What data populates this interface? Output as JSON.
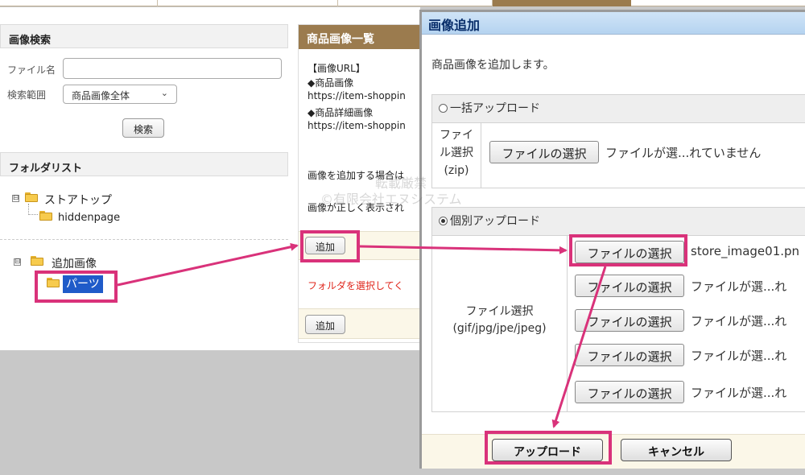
{
  "search": {
    "title": "画像検索",
    "filename_label": "ファイル名",
    "filename_value": "",
    "scope_label": "検索範囲",
    "scope_value": "商品画像全体",
    "search_button": "検索"
  },
  "folders": {
    "title": "フォルダリスト",
    "tree": [
      {
        "label": "ストアトップ",
        "expander": "⊟"
      },
      {
        "label": "hiddenpage"
      },
      {
        "label": "追加画像",
        "expander": "⊟"
      },
      {
        "label": "パーツ",
        "selected": true
      }
    ]
  },
  "image_list": {
    "title": "商品画像一覧",
    "url_heading": "【画像URL】",
    "product_image_label": "◆商品画像",
    "product_image_url": "https://item-shoppin",
    "detail_image_label": "◆商品詳細画像",
    "detail_image_url": "https://item-shoppin",
    "add_note": "画像を追加する場合は",
    "display_note": "画像が正しく表示され",
    "add_button": "追加",
    "select_folder_msg": "フォルダを選択してく",
    "add_button_2": "追加"
  },
  "dialog": {
    "title": "画像追加",
    "intro": "商品画像を追加します。",
    "bulk": {
      "radio_label": "一括アップロード",
      "field_label_lines": [
        "ファイ",
        "ル選択",
        "(zip)"
      ],
      "button": "ファイルの選択",
      "status": "ファイルが選...れていません"
    },
    "single": {
      "radio_label": "個別アップロード",
      "field_label_lines": [
        "ファイル選択",
        "(gif/jpg/jpe/jpeg)"
      ],
      "files": [
        {
          "button": "ファイルの選択",
          "status": "store_image01.pn"
        },
        {
          "button": "ファイルの選択",
          "status": "ファイルが選...れ"
        },
        {
          "button": "ファイルの選択",
          "status": "ファイルが選...れ"
        },
        {
          "button": "ファイルの選択",
          "status": "ファイルが選...れ"
        },
        {
          "button": "ファイルの選択",
          "status": "ファイルが選...れ"
        }
      ]
    },
    "upload_button": "アップロード",
    "cancel_button": "キャンセル"
  },
  "watermark": {
    "line1": "転載厳禁",
    "line2": "©有限会社エヌシステム"
  },
  "colors": {
    "accent_brown": "#9b7b4e",
    "highlight_pink": "#d9327a",
    "dialog_title_blue": "#0a2f6b",
    "error_red": "#e0271d"
  }
}
